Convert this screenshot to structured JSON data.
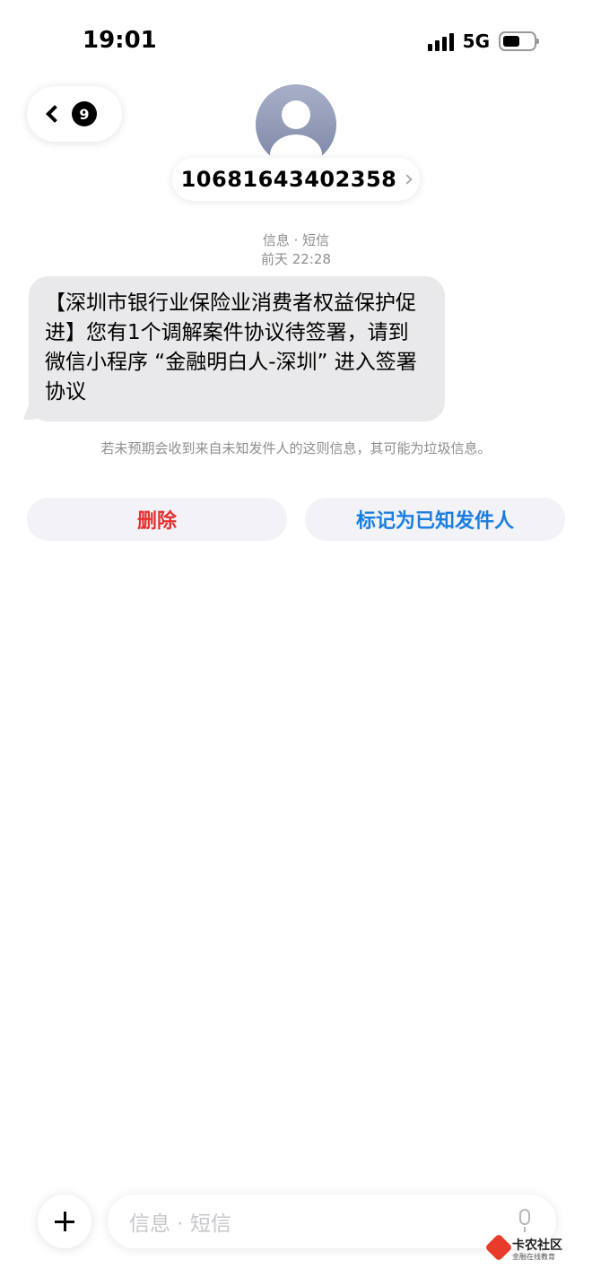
{
  "status_bar": {
    "time": "19:01",
    "network": "5G",
    "battery_level": 0.55
  },
  "header": {
    "back_count": "9",
    "sender_number": "10681643402358"
  },
  "conversation": {
    "channel_label": "信息 · 短信",
    "timestamp": "前天 22:28",
    "message": "【深圳市银行业保险业消费者权益保护促进】您有1个调解案件协议待签署，请到微信小程序 “金融明白人-深圳” 进入签署协议"
  },
  "warning": {
    "text": "若未预期会收到来自未知发件人的这则信息，其可能为垃圾信息。"
  },
  "actions": {
    "delete_label": "删除",
    "mark_known_label": "标记为已知发件人"
  },
  "composer": {
    "placeholder": "信息 · 短信"
  },
  "watermark": {
    "brand": "卡农社区",
    "tagline": "金融在线教育"
  },
  "colors": {
    "delete": "#e5312e",
    "accent": "#1a7ee0",
    "bubble": "#e9e9eb"
  }
}
